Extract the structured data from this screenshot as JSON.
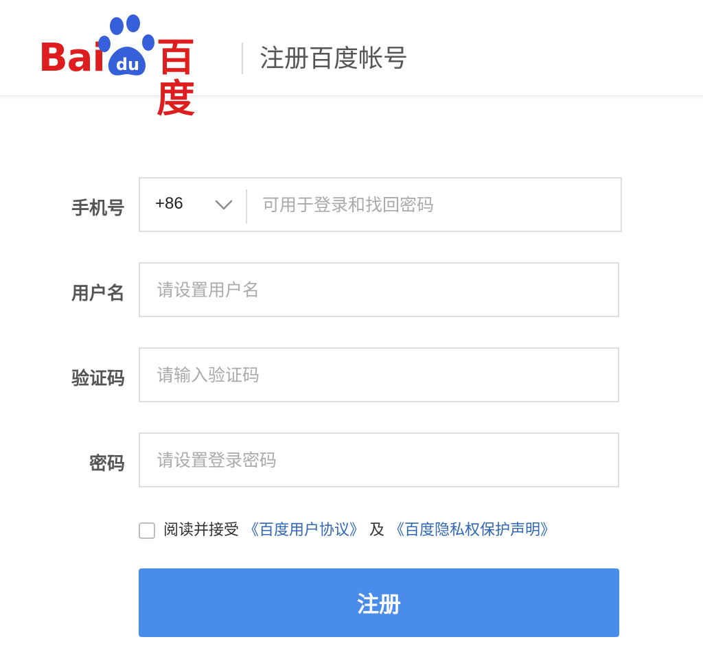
{
  "header": {
    "logo_latin": "Bai",
    "logo_du": "du",
    "logo_cn": "百度",
    "title": "注册百度帐号"
  },
  "form": {
    "phone": {
      "label": "手机号",
      "country_code": "+86",
      "placeholder": "可用于登录和找回密码"
    },
    "username": {
      "label": "用户名",
      "placeholder": "请设置用户名"
    },
    "captcha": {
      "label": "验证码",
      "placeholder": "请输入验证码"
    },
    "password": {
      "label": "密码",
      "placeholder": "请设置登录密码"
    },
    "agreement": {
      "prefix": "阅读并接受",
      "user_agreement_link": "《百度用户协议》",
      "conjunction": "及",
      "privacy_link": "《百度隐私权保护声明》",
      "checked": false
    },
    "submit_label": "注册"
  },
  "colors": {
    "brand_red": "#de1e1e",
    "brand_blue": "#3560d9",
    "link_blue": "#2f67b5",
    "button_blue": "#4a8cea"
  },
  "icons": {
    "logo_paw": "baidu-paw-icon",
    "country_dropdown": "chevron-down-icon",
    "agreement_checkbox": "checkbox-icon"
  }
}
